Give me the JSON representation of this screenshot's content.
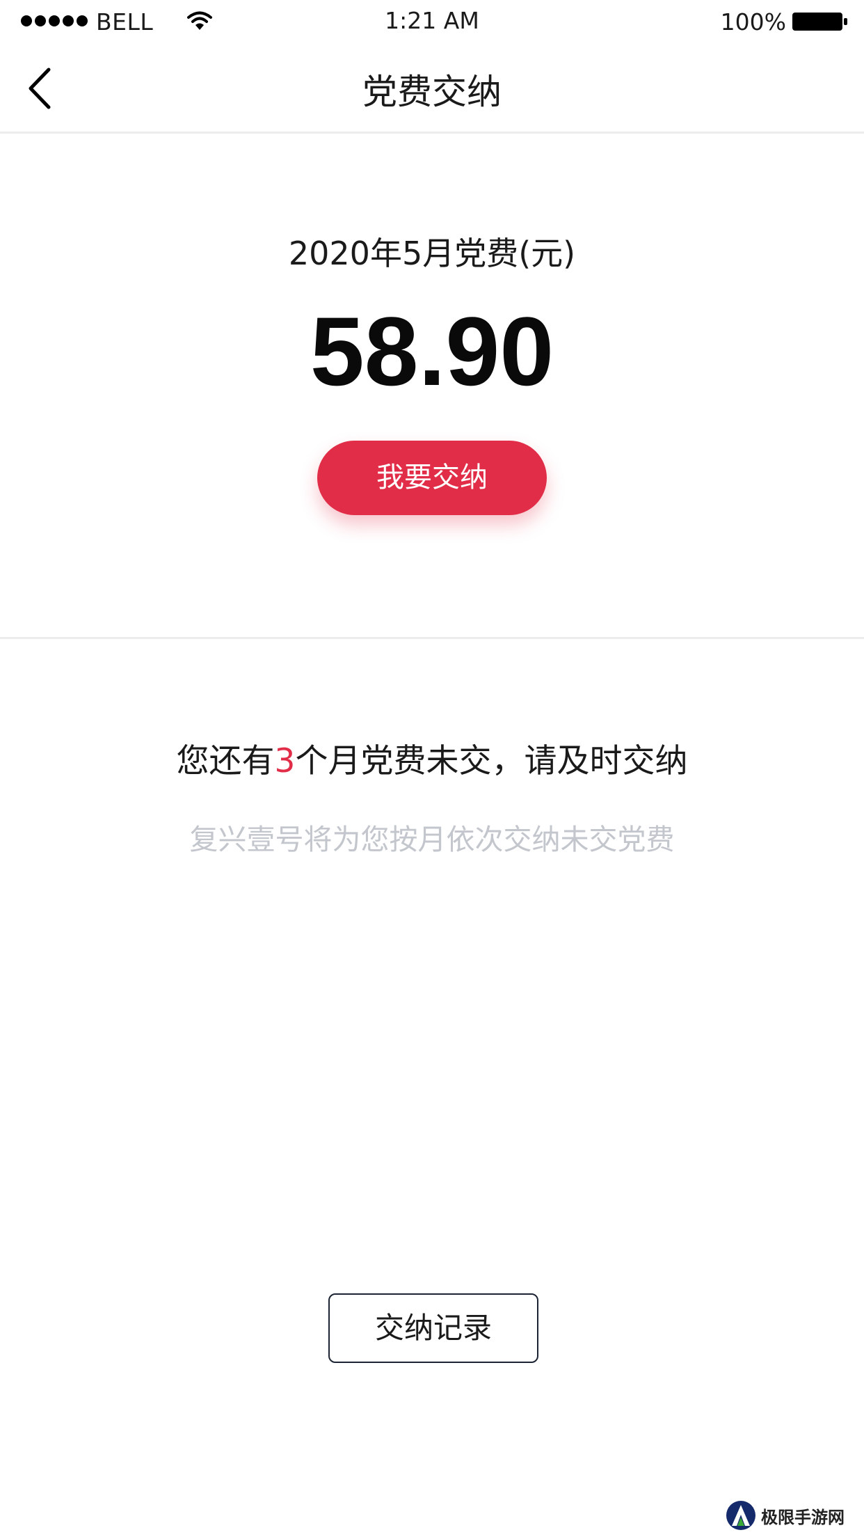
{
  "status_bar": {
    "carrier": "BELL",
    "time": "1:21 AM",
    "battery": "100%",
    "icons": [
      "signal-icon",
      "wifi-icon",
      "battery-icon"
    ]
  },
  "nav": {
    "title": "党费交纳",
    "back_icon": "chevron-left-icon"
  },
  "fee": {
    "period_label": "2020年5月党费(元)",
    "amount": "58.90",
    "pay_button_label": "我要交纳"
  },
  "notice": {
    "prefix": "您还有",
    "months": "3",
    "suffix": "个月党费未交，请及时交纳",
    "sub_text": "复兴壹号将为您按月依次交纳未交党费"
  },
  "records_button_label": "交纳记录",
  "watermark": {
    "text": "极限手游网"
  },
  "colors": {
    "accent": "#e12d48",
    "text_primary": "#1a1a1a",
    "text_muted": "#c3c6cc",
    "divider": "#ececec",
    "button_border": "#1c2333"
  }
}
